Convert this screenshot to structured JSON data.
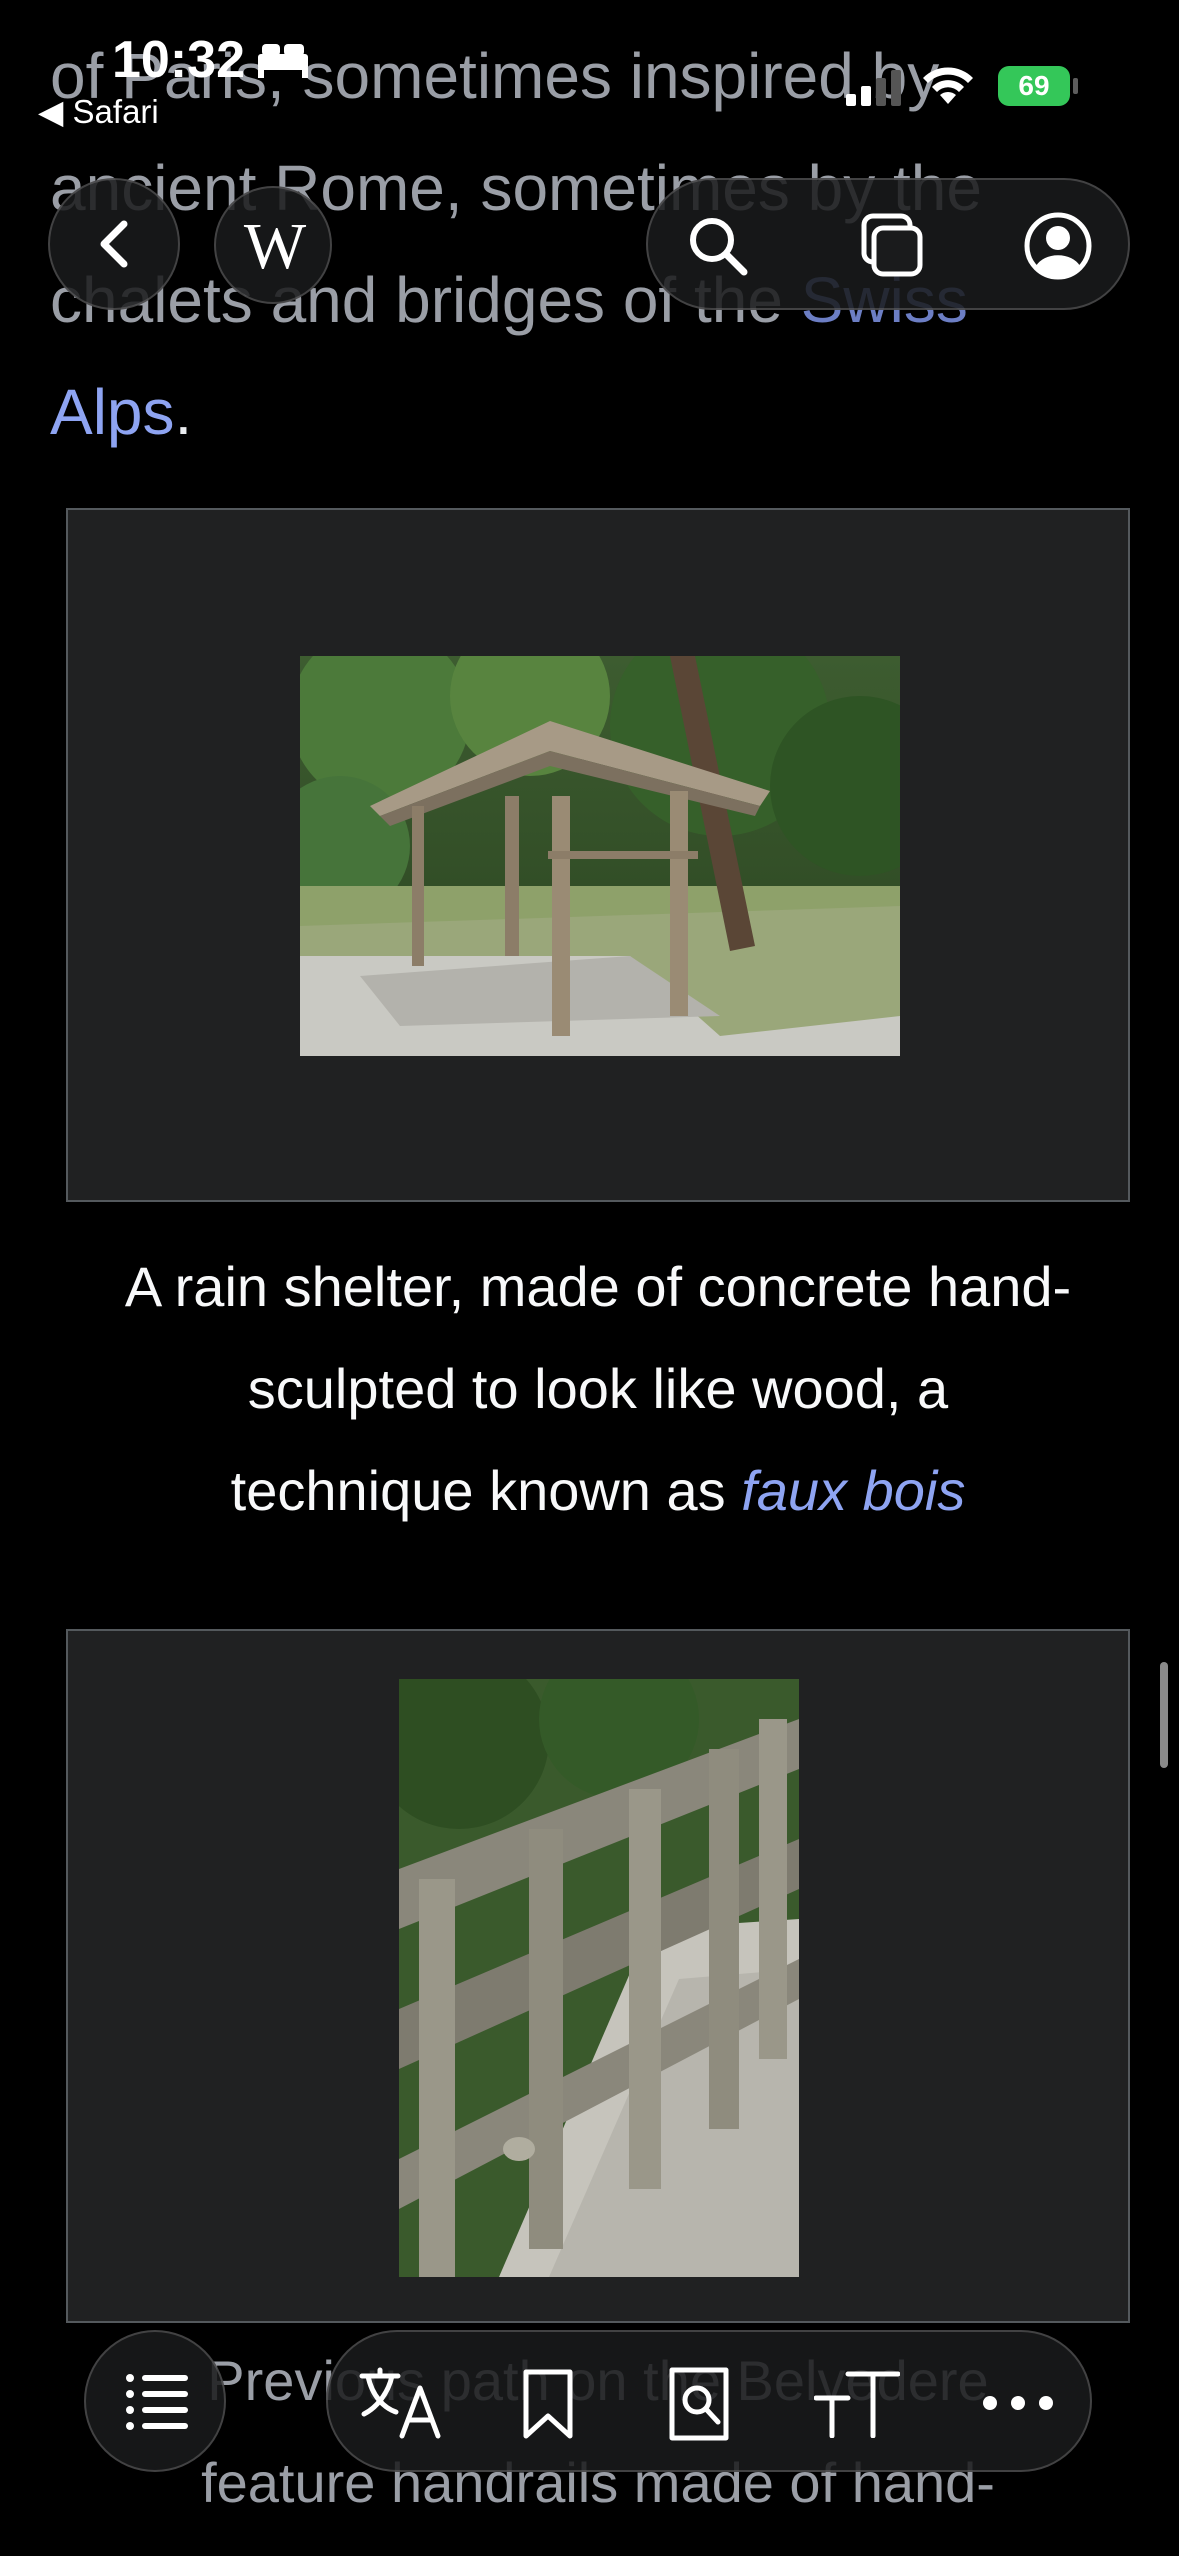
{
  "status_bar": {
    "time": "10:32",
    "back_app": "◀ Safari",
    "battery": "69"
  },
  "article": {
    "para_prev_line1": "of Paris, sometimes inspired by",
    "para_prev_line2": "ancient Rome, sometimes by the",
    "para_prev_line3_a": "chalets and bridges of the ",
    "para_prev_line3_link": "Swiss",
    "para_prev_link_end": "Alps",
    "para_prev_end": "."
  },
  "figures": [
    {
      "alt": "A rain shelter, made of concrete hand-sculpted to look like wood",
      "caption_a": "A rain shelter, made of concrete hand-",
      "caption_b": "sculpted to look like wood, a",
      "caption_c": "technique known as ",
      "caption_link": "faux bois"
    },
    {
      "alt": "Handrails made of hand-sculpted concrete on a path",
      "caption_a": "Previous path on the Belvedere",
      "caption_b": "feature handrails made of hand-"
    }
  ],
  "nav": {
    "wiki_logo": "W"
  },
  "toolbar": {
    "textsize_label": "TT"
  },
  "colors": {
    "link": "#8ea4f2",
    "figure_bg": "#202122",
    "battery": "#34c759"
  }
}
